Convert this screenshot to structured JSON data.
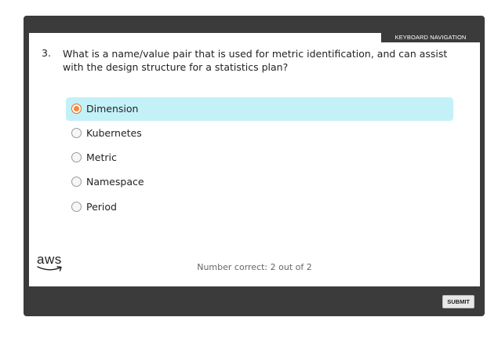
{
  "header": {
    "keyboard_nav_label": "KEYBOARD NAVIGATION"
  },
  "question": {
    "number": "3.",
    "text": "What is a name/value pair that is used for metric identification, and can assist with the design structure for a statistics plan?"
  },
  "options": [
    {
      "label": "Dimension",
      "selected": true
    },
    {
      "label": "Kubernetes",
      "selected": false
    },
    {
      "label": "Metric",
      "selected": false
    },
    {
      "label": "Namespace",
      "selected": false
    },
    {
      "label": "Period",
      "selected": false
    }
  ],
  "footer": {
    "logo_text": "aws",
    "score_text": "Number correct: 2 out of 2",
    "submit_label": "SUBMIT"
  },
  "colors": {
    "frame": "#3b3b3b",
    "selected_bg": "#c4f1f8",
    "radio_accent": "#f28a3a"
  }
}
